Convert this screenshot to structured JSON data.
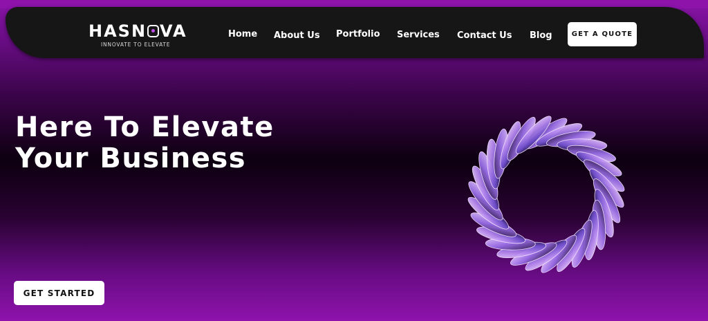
{
  "brand": {
    "name_part1": "HASN",
    "name_part2": "VA",
    "tagline": "INNOVATE TO ELEVATE"
  },
  "nav": {
    "links": [
      "Home",
      "About Us",
      "Portfolio",
      "Services",
      "Contact Us",
      "Blog"
    ],
    "cta_label": "GET A QUOTE"
  },
  "hero": {
    "headline_line1": "Here To Elevate",
    "headline_line2": "Your Business",
    "cta_label": "GET STARTED",
    "graphic_icon": "abstract-spiral-ring"
  },
  "colors": {
    "accent_purple": "#8d13ab",
    "navbar_bg": "#161616",
    "button_bg": "#ffffff"
  }
}
